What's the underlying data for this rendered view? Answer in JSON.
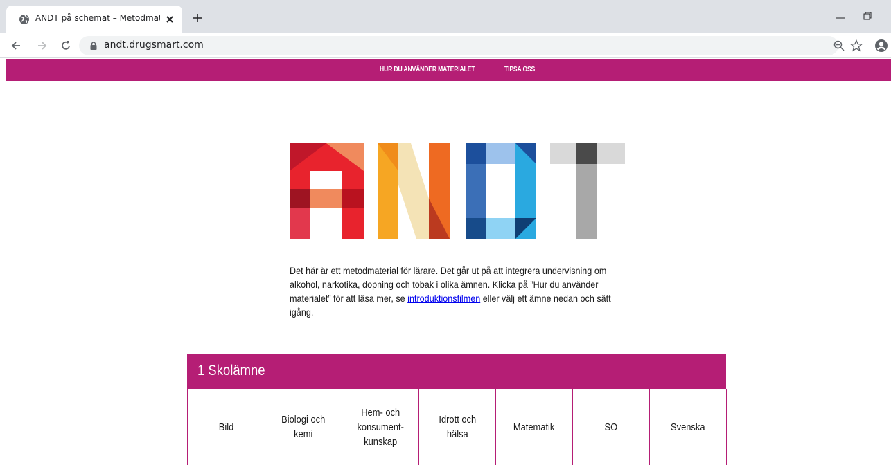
{
  "browser": {
    "tab_title": "ANDT på schemat – Metodmater",
    "url": "andt.drugsmart.com"
  },
  "site_nav": {
    "how_to_use": "HUR DU ANVÄNDER MATERIALET",
    "tips": "TIPSA OSS"
  },
  "logo": {
    "letters": "ANDT",
    "colors": {
      "A": [
        "#e8232d",
        "#f08a5d",
        "#c0172a",
        "#e2384d"
      ],
      "N": [
        "#f6a623",
        "#f4e3b6",
        "#ee6a22",
        "#bb3a1f"
      ],
      "D": [
        "#1c4f9c",
        "#9dc2ec",
        "#2aa9e0",
        "#0f3e73"
      ],
      "T": [
        "#d9d9d9",
        "#4a4a4a",
        "#a8a8a8"
      ]
    }
  },
  "intro": {
    "text_before": "Det här är ett metodmaterial för lärare. Det går ut på att integrera undervisning om alkohol, narkotika, dopning och tobak i olika ämnen. Klicka på ”Hur du använder materialet”  för att läsa mer, se ",
    "link": "introduktionsfilmen",
    "text_after": " eller välj ett ämne nedan och sätt igång."
  },
  "subjects": {
    "title": "1 Skolämne",
    "items": [
      {
        "label": "Bild"
      },
      {
        "label": "Biologi och\nkemi"
      },
      {
        "label": "Hem- och\nkonsument-\nkunskap"
      },
      {
        "label": "Idrott och\nhälsa"
      },
      {
        "label": "Matematik"
      },
      {
        "label": "SO"
      },
      {
        "label": "Svenska"
      }
    ]
  },
  "colors": {
    "brand": "#b51e75",
    "tabstrip": "#dee1e6",
    "link": "#0000ee"
  }
}
